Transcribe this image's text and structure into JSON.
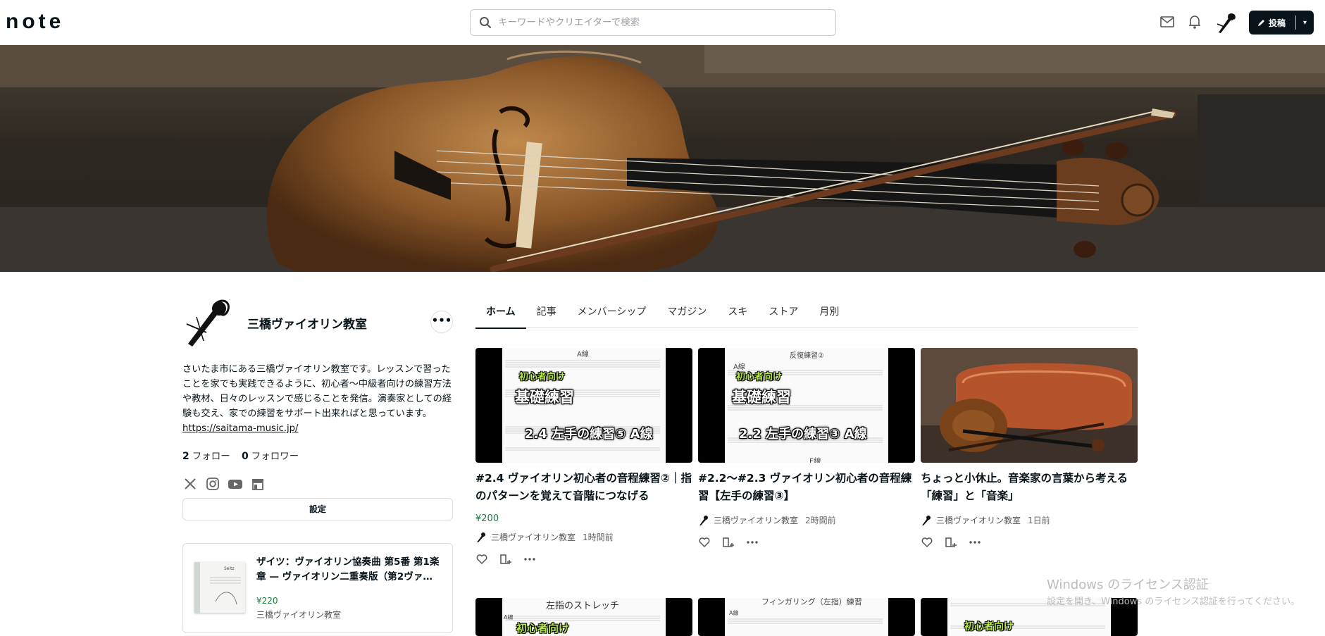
{
  "header": {
    "logo": "note",
    "search_placeholder": "キーワードやクリエイターで検索",
    "post_label": "投稿"
  },
  "profile": {
    "name": "三橋ヴァイオリン教室",
    "more_label": "•••",
    "bio": "さいたま市にある三橋ヴァイオリン教室です。レッスンで習ったことを家でも実践できるように、初心者〜中級者向けの練習方法や教材、日々のレッスンで感じることを発信。演奏家としての経験も交え、家での練習をサポート出来ればと思っています。",
    "link": "https://saitama-music.jp/",
    "following_count": "2",
    "following_label": "フォロー",
    "followers_count": "0",
    "followers_label": "フォロワー",
    "settings_label": "設定"
  },
  "product": {
    "title": "ザイツ：ヴァイオリン協奏曲 第5番 第1楽章 — ヴァイオリン二重奏版（第2ヴァ…",
    "price": "¥220",
    "author": "三橋ヴァイオリン教室",
    "thumb_text": "Seitz"
  },
  "tabs": [
    {
      "label": "ホーム",
      "active": true
    },
    {
      "label": "記事"
    },
    {
      "label": "メンバーシップ"
    },
    {
      "label": "マガジン"
    },
    {
      "label": "スキ"
    },
    {
      "label": "ストア"
    },
    {
      "label": "月別"
    }
  ],
  "cards": [
    {
      "title": "#2.4 ヴァイオリン初心者の音程練習②｜指のパターンを覚えて音階につなげる",
      "price": "¥200",
      "author": "三橋ヴァイオリン教室",
      "time": "1時間前",
      "thumb": {
        "top": "A線",
        "badge": "初心者向け",
        "big": "基礎練習",
        "sub": "2.4 左手の練習⑤ A線"
      }
    },
    {
      "title": "#2.2〜#2.3 ヴァイオリン初心者の音程練習【左手の練習③】",
      "author": "三橋ヴァイオリン教室",
      "time": "2時間前",
      "thumb": {
        "top": "反復練習②",
        "string": "A線",
        "bottom": "E線",
        "badge": "初心者向け",
        "big": "基礎練習",
        "sub": "2.2 左手の練習③ A線"
      }
    },
    {
      "title": "ちょっと小休止。音楽家の言葉から考える「練習」と「音楽」",
      "author": "三橋ヴァイオリン教室",
      "time": "1日前"
    }
  ],
  "bottom_cards": [
    {
      "top": "左指のストレッチ",
      "badge": "初心者向け",
      "string": "A線"
    },
    {
      "top": "フィンガリング（左指）練習",
      "string": "A線"
    },
    {
      "badge": "初心者向け"
    }
  ],
  "watermark": {
    "line1": "Windows のライセンス認証",
    "line2": "設定を開き、Windows のライセンス認証を行ってください。"
  }
}
